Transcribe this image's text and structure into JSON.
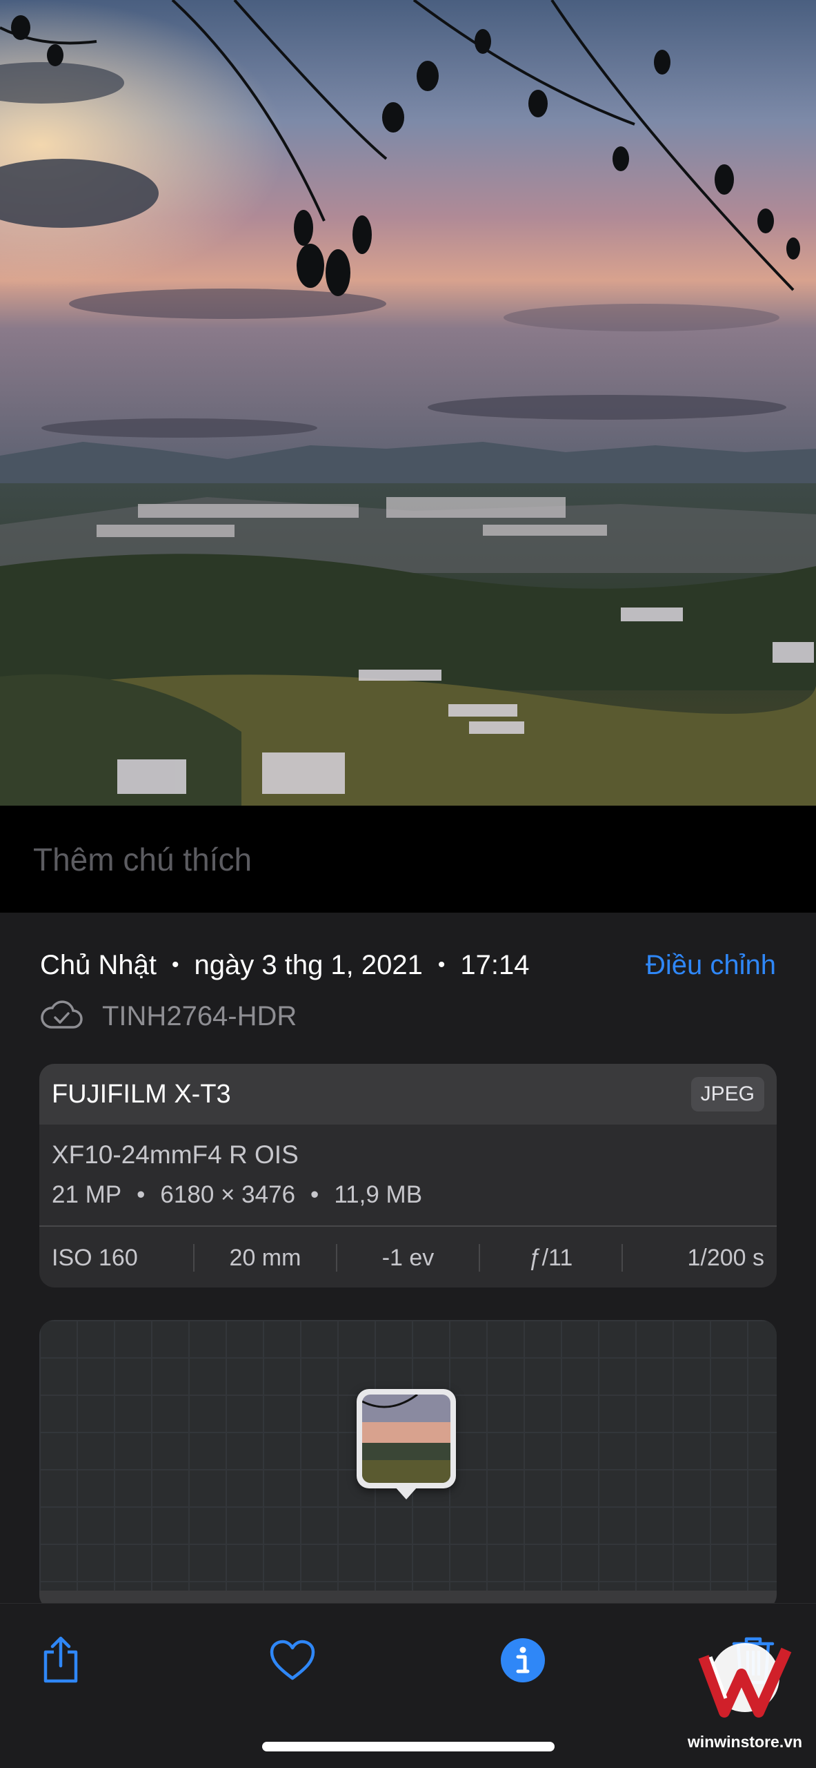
{
  "caption": {
    "placeholder": "Thêm chú thích"
  },
  "info": {
    "day": "Chủ Nhật",
    "date": "ngày 3 thg 1, 2021",
    "time": "17:14",
    "adjust_label": "Điều chỉnh",
    "filename": "TINH2764-HDR"
  },
  "exif": {
    "camera": "FUJIFILM X-T3",
    "format": "JPEG",
    "lens": "XF10-24mmF4 R OIS",
    "megapixels": "21 MP",
    "resolution": "6180 × 3476",
    "file_size": "11,9 MB",
    "iso": "ISO 160",
    "focal_length": "20 mm",
    "exposure_bias": "-1 ev",
    "aperture": "ƒ/11",
    "shutter": "1/200 s"
  },
  "watermark": {
    "text": "winwinstore.vn"
  },
  "colors": {
    "accent": "#2f87f7",
    "panel_bg": "#1c1c1e",
    "card_bg": "#2c2c2e",
    "brand_red": "#d0202a"
  },
  "icons": [
    "cloud-check-icon",
    "share-icon",
    "heart-icon",
    "info-icon",
    "trash-icon"
  ]
}
